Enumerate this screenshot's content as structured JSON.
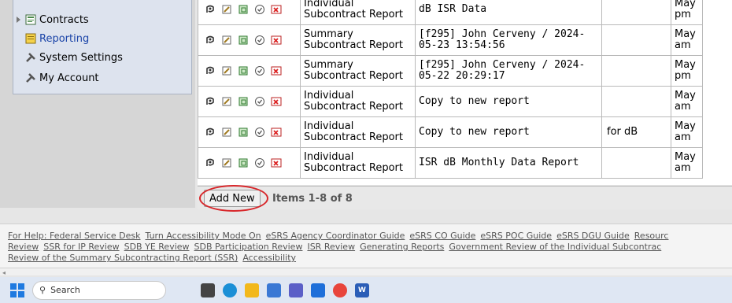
{
  "sidebar": {
    "items": [
      {
        "label": "Contracts",
        "icon": "contracts-icon"
      },
      {
        "label": "Reporting",
        "icon": "reporting-icon"
      },
      {
        "label": "System Settings",
        "icon": "wrench-icon"
      },
      {
        "label": "My Account",
        "icon": "wrench-icon"
      }
    ]
  },
  "table": {
    "row_actions": [
      "view-icon",
      "edit-icon",
      "copy-icon",
      "status-icon",
      "delete-icon"
    ],
    "rows": [
      {
        "type": "Individual Subcontract Report",
        "name": "dB ISR Data",
        "extra": "",
        "date": "May pm"
      },
      {
        "type": "Summary Subcontract Report",
        "name": "[f295] John Cerveny / 2024-05-23 13:54:56",
        "extra": "",
        "date": "May am"
      },
      {
        "type": "Summary Subcontract Report",
        "name": "[f295] John Cerveny / 2024-05-22 20:29:17",
        "extra": "",
        "date": "May pm"
      },
      {
        "type": "Individual Subcontract Report",
        "name": "Copy to new report",
        "extra": "",
        "date": "May am"
      },
      {
        "type": "Individual Subcontract Report",
        "name": "Copy to new report",
        "extra": "for dB",
        "date": "May am"
      },
      {
        "type": "Individual Subcontract Report",
        "name": "ISR dB Monthly Data Report",
        "extra": "",
        "date": "May am"
      }
    ]
  },
  "pager": {
    "add_new_label": "Add New",
    "items_count": "Items 1-8 of 8"
  },
  "footer": {
    "line1": [
      "For Help: Federal Service Desk",
      "Turn Accessibility Mode On",
      "eSRS Agency Coordinator Guide",
      "eSRS CO Guide",
      "eSRS POC Guide",
      "eSRS DGU Guide",
      "Resourc"
    ],
    "line2": [
      "Review",
      "SSR for IP Review",
      "SDB YE Review",
      "SDB Participation Review",
      "ISR Review",
      "Generating Reports",
      "Government Review of the Individual Subcontrac"
    ],
    "line3": [
      "Review of the Summary Subcontracting Report (SSR)",
      "Accessibility"
    ]
  },
  "taskbar": {
    "search_placeholder": "Search"
  },
  "colors": {
    "accent_red": "#d8262a",
    "link_blue": "#1a44a8",
    "taskbar_bg": "#dfe7f3"
  }
}
